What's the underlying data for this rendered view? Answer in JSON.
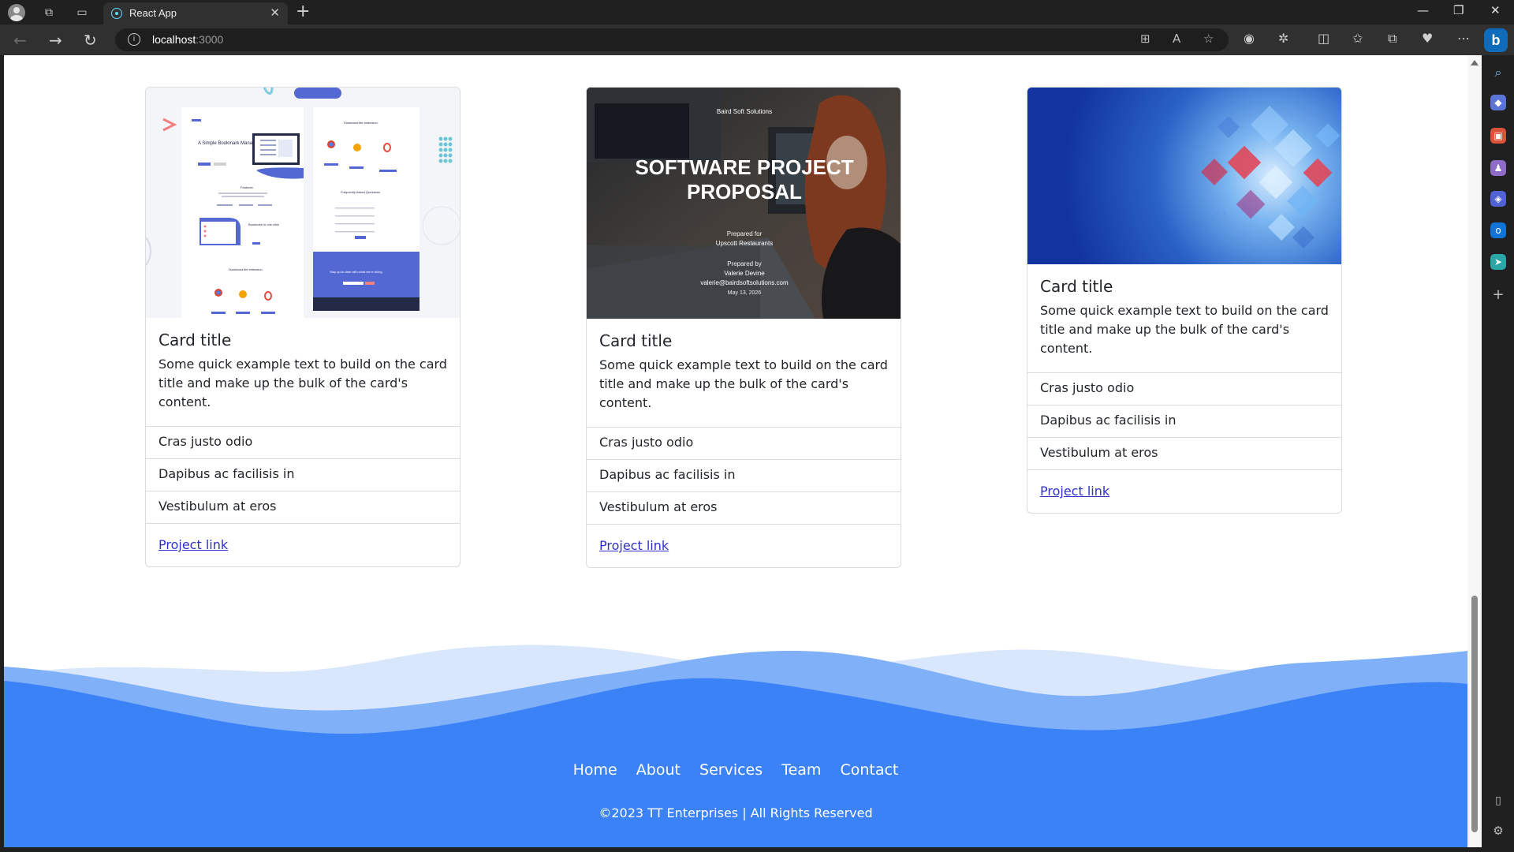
{
  "browser": {
    "tab_title": "React App",
    "url_host": "localhost",
    "url_port": ":3000"
  },
  "cards": [
    {
      "title": "Card title",
      "text": "Some quick example text to build on the card title and make up the bulk of the card's content.",
      "items": [
        "Cras justo odio",
        "Dapibus ac facilisis in",
        "Vestibulum at eros"
      ],
      "link": "Project link",
      "image": {
        "headline": "A Simple Bookmark Manager",
        "features": "Features",
        "download_heading": "Download the extension",
        "download_heading_2": "Download the extension",
        "faq_heading": "Frequently Asked Questions",
        "bookmark_heading": "Bookmark in one click",
        "cta": "Stay up-to-date with what we're doing"
      }
    },
    {
      "title": "Card title",
      "text": "Some quick example text to build on the card title and make up the bulk of the card's content.",
      "items": [
        "Cras justo odio",
        "Dapibus ac facilisis in",
        "Vestibulum at eros"
      ],
      "link": "Project link",
      "image": {
        "company": "Baird Soft Solutions",
        "headline_1": "SOFTWARE PROJECT",
        "headline_2": "PROPOSAL",
        "prepared_for": "Prepared for",
        "client": "Upscott Restaurants",
        "prepared_by": "Prepared by",
        "author": "Valerie Devine",
        "email": "valerie@bairdsoftsolutions.com",
        "date": "May 13, 2026"
      }
    },
    {
      "title": "Card title",
      "text": "Some quick example text to build on the card title and make up the bulk of the card's content.",
      "items": [
        "Cras justo odio",
        "Dapibus ac facilisis in",
        "Vestibulum at eros"
      ],
      "link": "Project link"
    }
  ],
  "footer": {
    "nav": [
      "Home",
      "About",
      "Services",
      "Team",
      "Contact"
    ],
    "copyright": "©2023 TT Enterprises | All Rights Reserved"
  },
  "colors": {
    "footer_blue": "#3b82f6",
    "wave_light": "#bfd7fb",
    "link": "#2f2fc9"
  }
}
